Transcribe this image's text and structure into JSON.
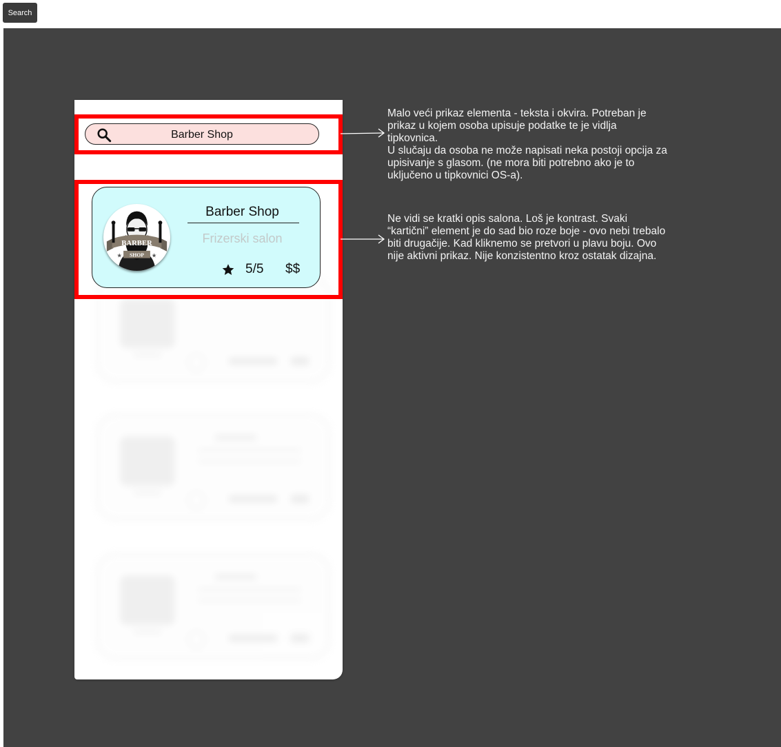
{
  "toolbar": {
    "search_label": "Search"
  },
  "mockup": {
    "search_bar": {
      "value": "Barber Shop",
      "icon": "search-icon"
    },
    "card": {
      "title": "Barber Shop",
      "subtitle": "Frizerski salon",
      "rating": "5/5",
      "price": "$$",
      "logo_top_text": "BARBER",
      "logo_bottom_text": "SHOP",
      "colors": {
        "card_bg": "#d1fbfc",
        "search_bg": "#fce0de",
        "highlight": "#ff0000"
      }
    }
  },
  "annotations": [
    {
      "text": "Malo veći prikaz elementa - teksta i okvira. Potreban je\nprikaz u kojem osoba upisuje podatke te je vidlja\ntipkovnica.\nU slučaju da osoba ne može napisati neka postoji opcija za\nupisivanje s glasom. (ne mora biti potrebno ako je to\nuključeno u tipkovnici OS-a)."
    },
    {
      "text": "Ne vidi se kratki opis salona. Loš je kontrast. Svaki\n“kartični” element je do sad bio roze boje - ovo nebi trebalo\nbiti drugačije. Kad kliknemo se pretvori u plavu boju. Ovo\nnije aktivni prikaz. Nije konzistentno kroz ostatak dizajna."
    }
  ]
}
